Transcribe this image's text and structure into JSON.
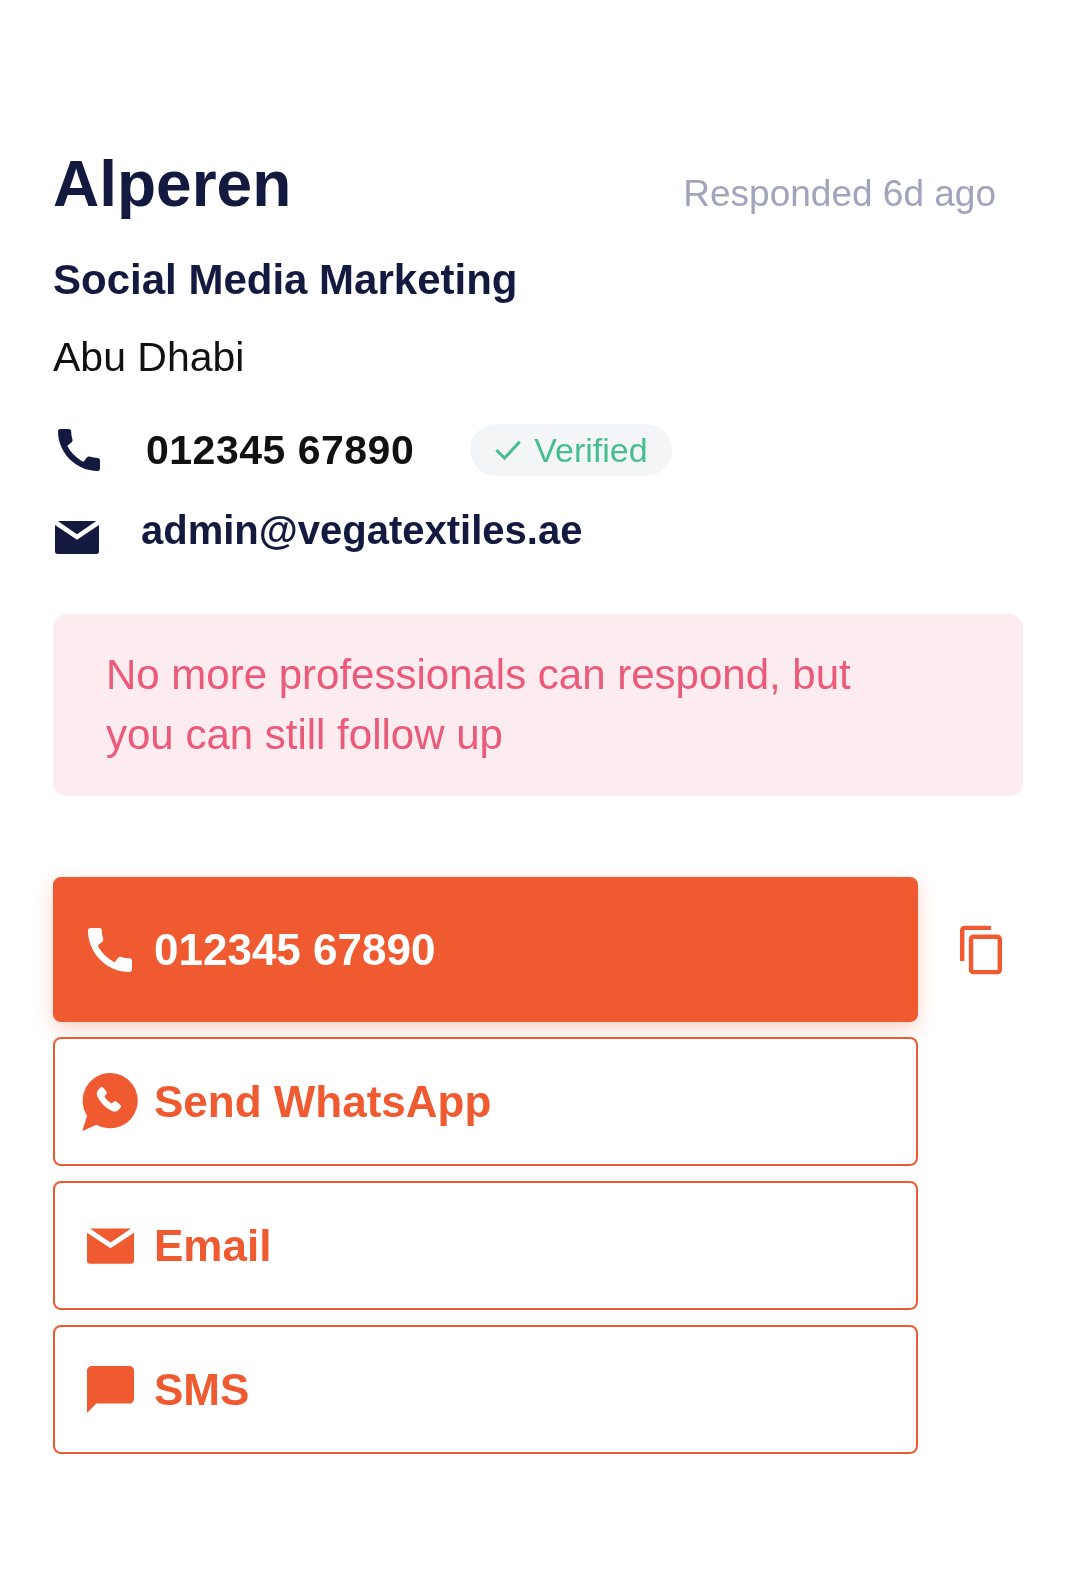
{
  "contact": {
    "name": "Alperen",
    "response_status": "Responded 6d ago",
    "service": "Social Media Marketing",
    "location": "Abu Dhabi",
    "phone": "012345 67890",
    "phone_verified": true,
    "verified_label": "Verified",
    "email": "admin@vegatextiles.ae"
  },
  "notice": {
    "text": "No more professionals can respond, but you can still follow up"
  },
  "actions": [
    {
      "kind": "call",
      "label": "012345 67890",
      "primary": true,
      "copyable": true
    },
    {
      "kind": "whatsapp",
      "label": "Send WhatsApp",
      "primary": false,
      "copyable": false
    },
    {
      "kind": "email",
      "label": "Email",
      "primary": false,
      "copyable": false
    },
    {
      "kind": "sms",
      "label": "SMS",
      "primary": false,
      "copyable": false
    }
  ]
}
